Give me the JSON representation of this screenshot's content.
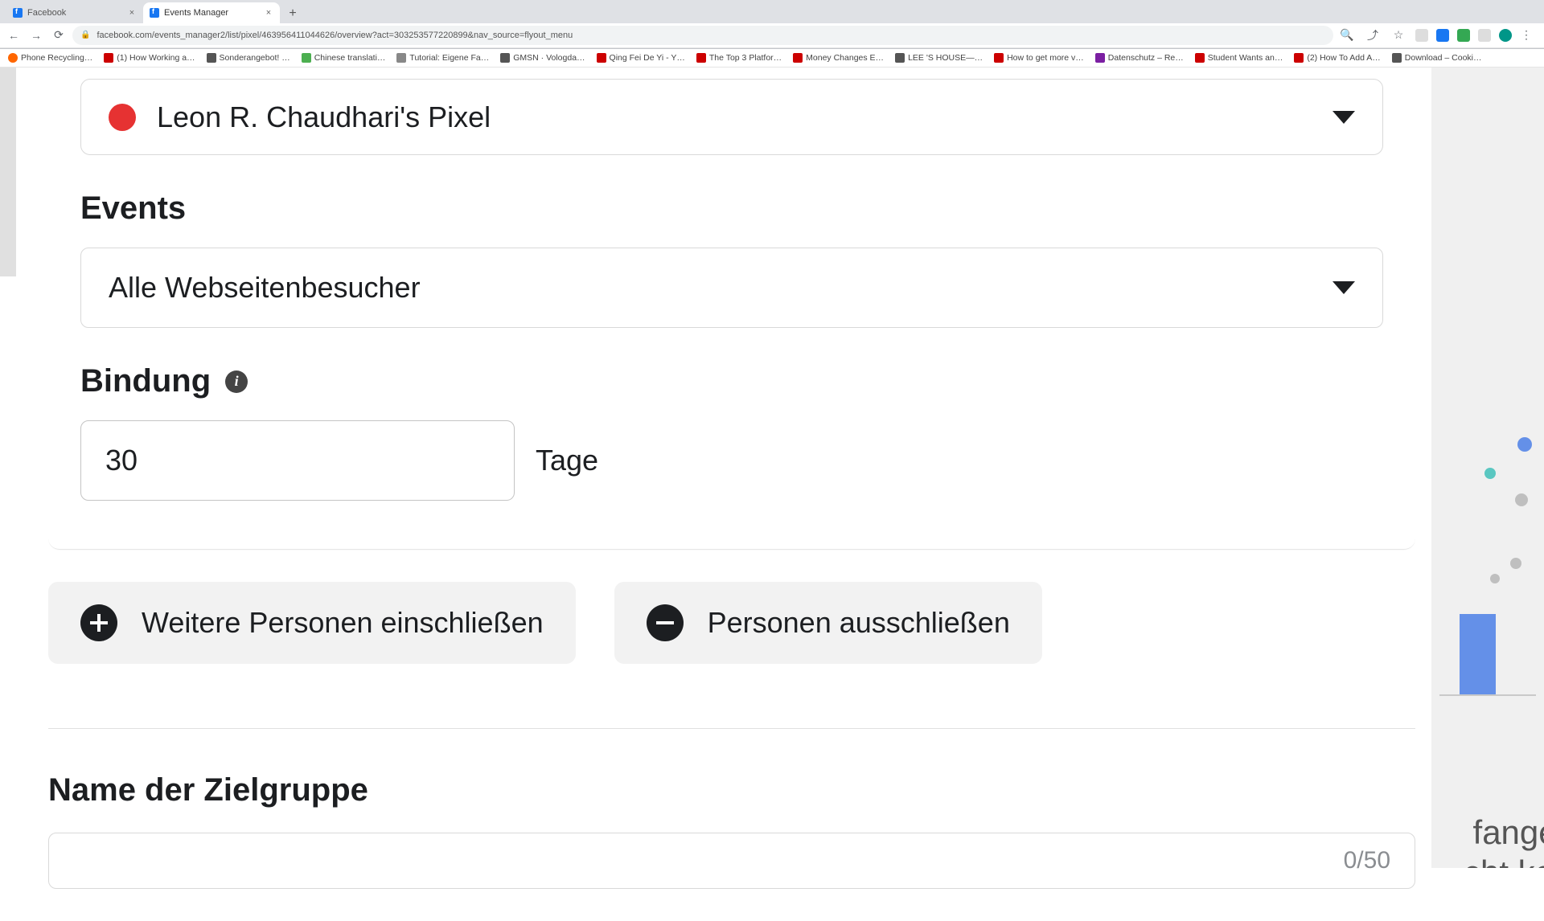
{
  "browser": {
    "tabs": [
      {
        "title": "Facebook",
        "active": false
      },
      {
        "title": "Events Manager",
        "active": true
      }
    ],
    "url": "facebook.com/events_manager2/list/pixel/463956411044626/overview?act=303253577220899&nav_source=flyout_menu"
  },
  "bookmarks": [
    "Phone Recycling…",
    "(1) How Working a…",
    "Sonderangebot! …",
    "Chinese translati…",
    "Tutorial: Eigene Fa…",
    "GMSN · Vologda…",
    "Qing Fei De Yi - Y…",
    "The Top 3 Platfor…",
    "Money Changes E…",
    "LEE 'S HOUSE—…",
    "How to get more v…",
    "Datenschutz – Re…",
    "Student Wants an…",
    "(2) How To Add A…",
    "Download – Cooki…"
  ],
  "source": {
    "label": "Leon R. Chaudhari's Pixel"
  },
  "events": {
    "heading": "Events",
    "selected": "Alle Webseitenbesucher"
  },
  "retention": {
    "heading": "Bindung",
    "value": "30",
    "unit": "Tage"
  },
  "actions": {
    "include": "Weitere Personen einschließen",
    "exclude": "Personen ausschließen"
  },
  "audience_name": {
    "heading": "Name der Zielgruppe",
    "counter": "0/50"
  },
  "bg": {
    "line1": "fangen",
    "line2": "cht korr"
  }
}
